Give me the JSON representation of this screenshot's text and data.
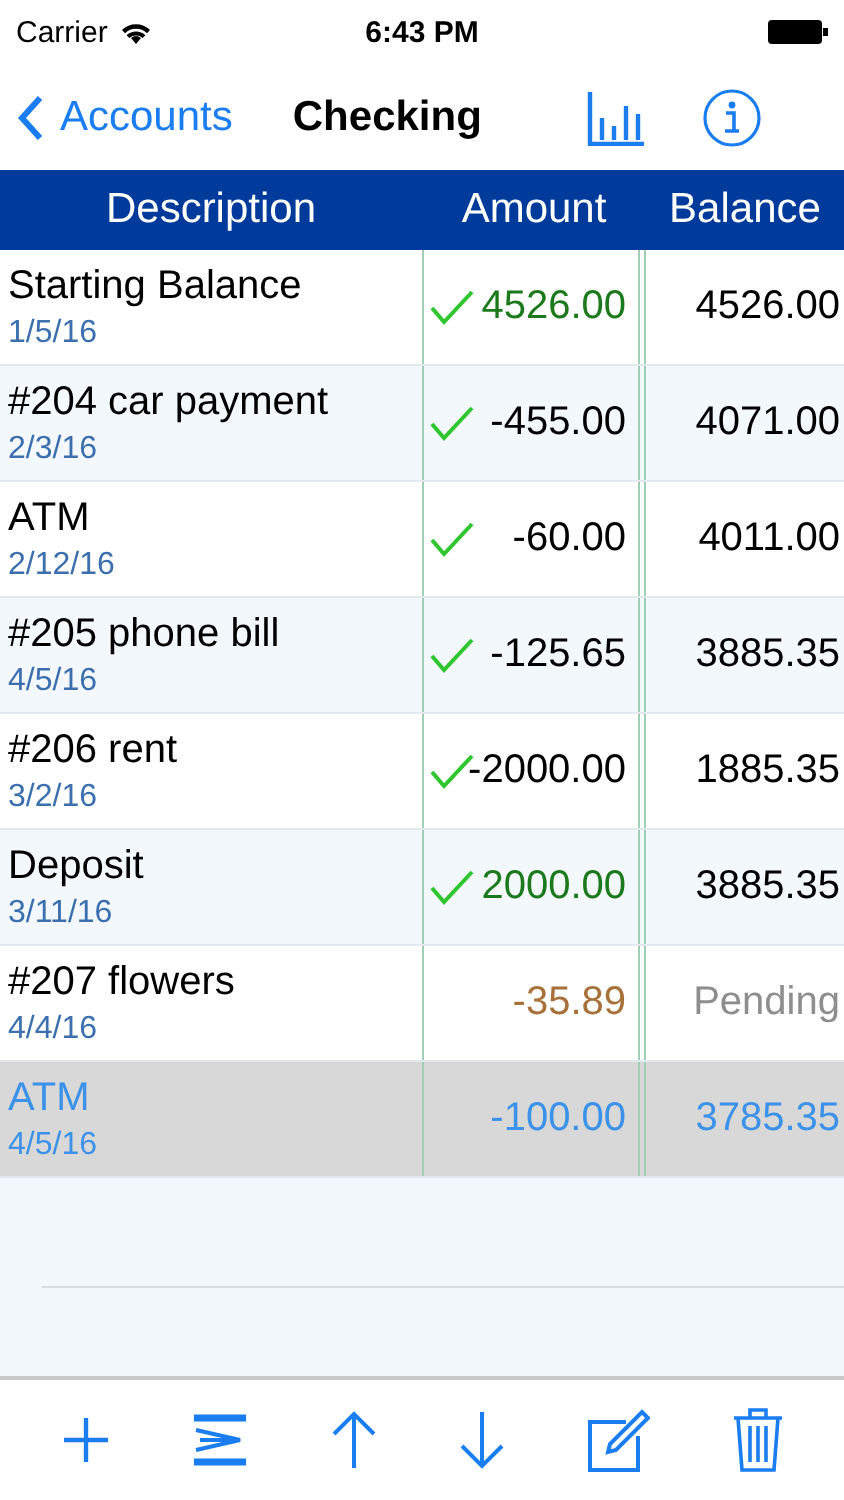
{
  "status_bar": {
    "carrier": "Carrier",
    "time": "6:43 PM"
  },
  "nav": {
    "back": "Accounts",
    "title": "Checking"
  },
  "table": {
    "columns": [
      "Description",
      "Amount",
      "Balance"
    ],
    "rows": [
      {
        "description": "Starting Balance",
        "date": "1/5/16",
        "amount": "4526.00",
        "balance": "4526.00",
        "kind": "deposit",
        "cleared": true,
        "pending": false,
        "selected": false
      },
      {
        "description": "#204 car payment",
        "date": "2/3/16",
        "amount": "-455.00",
        "balance": "4071.00",
        "kind": "payment",
        "cleared": true,
        "pending": false,
        "selected": false
      },
      {
        "description": "ATM",
        "date": "2/12/16",
        "amount": "-60.00",
        "balance": "4011.00",
        "kind": "payment",
        "cleared": true,
        "pending": false,
        "selected": false
      },
      {
        "description": "#205 phone bill",
        "date": "4/5/16",
        "amount": "-125.65",
        "balance": "3885.35",
        "kind": "payment",
        "cleared": true,
        "pending": false,
        "selected": false
      },
      {
        "description": "#206 rent",
        "date": "3/2/16",
        "amount": "-2000.00",
        "balance": "1885.35",
        "kind": "payment",
        "cleared": true,
        "pending": false,
        "selected": false
      },
      {
        "description": "Deposit",
        "date": "3/11/16",
        "amount": "2000.00",
        "balance": "3885.35",
        "kind": "deposit",
        "cleared": true,
        "pending": false,
        "selected": false
      },
      {
        "description": "#207 flowers",
        "date": "4/4/16",
        "amount": "-35.89",
        "balance": "Pending",
        "kind": "payment",
        "cleared": false,
        "pending": true,
        "selected": false
      },
      {
        "description": "ATM",
        "date": "4/5/16",
        "amount": "-100.00",
        "balance": "3785.35",
        "kind": "payment",
        "cleared": false,
        "pending": false,
        "selected": true
      }
    ]
  }
}
